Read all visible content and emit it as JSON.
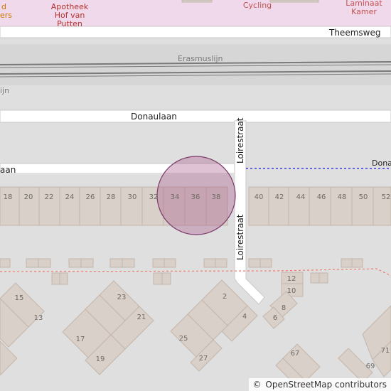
{
  "map": {
    "colors": {
      "background": "#e0dfdf",
      "retail_area": "#f0d9ea",
      "road": "#ffffff",
      "road_casing": "#c8c8c8",
      "building": "#d9d0c9",
      "building_outline": "#c4b6ab",
      "railway": "#7a7a7a",
      "admin_boundary": "#1a1ae0",
      "path_red": "#f07b6e",
      "shop_label": "#c45252",
      "pharmacy_label": "#b3332e",
      "amber_label": "#c77400",
      "marker_fill": "#a25488",
      "marker_stroke": "#7d3a6b"
    },
    "labels": {
      "pharmacy": "Apotheek Hof van Putten",
      "pharmacy_lines": [
        "Apotheek",
        "Hof van",
        "Putten"
      ],
      "cycling": "Cycling",
      "laminaat": "Laminaat Kamer",
      "laminaat_lines": [
        "Laminaat",
        "Kamer"
      ],
      "amber_lines": [
        "d",
        "ers"
      ]
    },
    "streets": {
      "theemsweg": "Theemsweg",
      "erasmuslijn": "Erasmuslijn",
      "donaulaan": "Donaulaan",
      "donaulaan_left_partial": "aan",
      "donaulaan_right_partial": "Dona",
      "loirestraat_north": "Loirestraat",
      "loirestraat_south": "Loirestraat",
      "rail_partial": "ijn"
    },
    "house_numbers": {
      "upper_row": [
        "18",
        "20",
        "22",
        "24",
        "26",
        "28",
        "30",
        "32",
        "34",
        "36",
        "38",
        "40",
        "42",
        "44",
        "46",
        "48",
        "50",
        "52"
      ],
      "lower_right": [
        "12",
        "10",
        "8",
        "6"
      ],
      "blocks": [
        "15",
        "13",
        "23",
        "21",
        "17",
        "19",
        "2",
        "4",
        "25",
        "27",
        "67",
        "71",
        "69"
      ]
    },
    "attribution": {
      "copyright_symbol": "©",
      "text": "OpenStreetMap contributors"
    }
  }
}
